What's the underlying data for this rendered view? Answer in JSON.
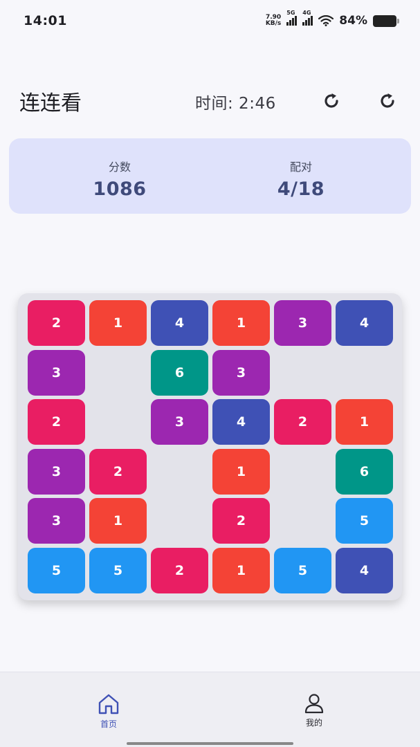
{
  "status_bar": {
    "time": "14:01",
    "net_speed_value": "7.90",
    "net_speed_unit": "KB/s",
    "sig1_tag": "5G",
    "sig2_tag": "4G",
    "battery": "84%"
  },
  "header": {
    "title": "连连看",
    "timer_label": "时间: 2:46",
    "refresh_icon_1": "refresh-icon",
    "refresh_icon_2": "refresh-icon"
  },
  "score_card": {
    "score_label": "分数",
    "score_value": "1086",
    "pairs_label": "配对",
    "pairs_value": "4/18"
  },
  "board": {
    "rows": 6,
    "cols": 6,
    "colors": {
      "1": "#f44336",
      "2": "#e91e63",
      "3": "#9c27b0",
      "4": "#3f51b5",
      "5": "#2196f3",
      "6": "#009688"
    },
    "tiles": [
      [
        "2",
        "1",
        "4",
        "1",
        "3",
        "4"
      ],
      [
        "3",
        "",
        "6",
        "3",
        "",
        ""
      ],
      [
        "2",
        "",
        "3",
        "4",
        "2",
        "1"
      ],
      [
        "3",
        "2",
        "",
        "1",
        "",
        "6"
      ],
      [
        "3",
        "1",
        "",
        "2",
        "",
        "5"
      ],
      [
        "5",
        "5",
        "2",
        "1",
        "5",
        "4"
      ]
    ]
  },
  "bottom_nav": {
    "home_label": "首页",
    "home_color": "#3f51b5",
    "mine_label": "我的",
    "mine_color": "#2a2a30"
  }
}
